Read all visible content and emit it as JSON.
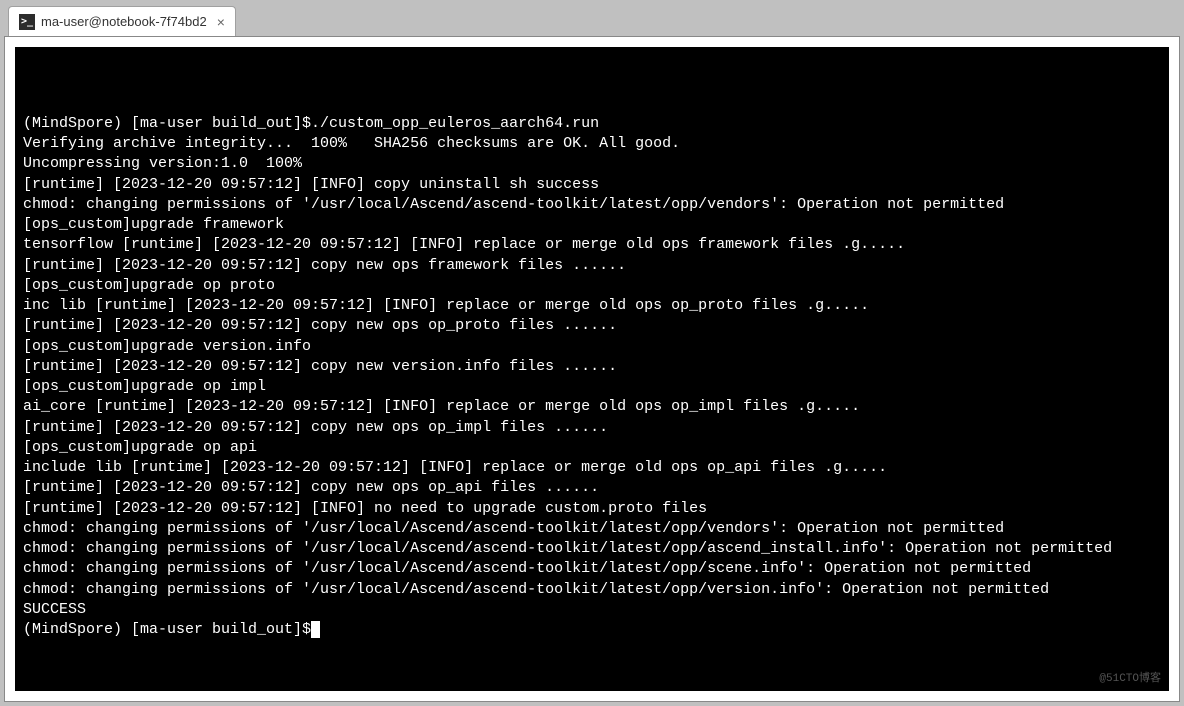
{
  "tab": {
    "title": "ma-user@notebook-7f74bd2",
    "icon_glyph": ">_"
  },
  "terminal": {
    "lines": [
      "(MindSpore) [ma-user build_out]$./custom_opp_euleros_aarch64.run",
      "Verifying archive integrity...  100%   SHA256 checksums are OK. All good.",
      "Uncompressing version:1.0  100%",
      "[runtime] [2023-12-20 09:57:12] [INFO] copy uninstall sh success",
      "chmod: changing permissions of '/usr/local/Ascend/ascend-toolkit/latest/opp/vendors': Operation not permitted",
      "[ops_custom]upgrade framework",
      "tensorflow [runtime] [2023-12-20 09:57:12] [INFO] replace or merge old ops framework files .g.....",
      "[runtime] [2023-12-20 09:57:12] copy new ops framework files ......",
      "[ops_custom]upgrade op proto",
      "inc lib [runtime] [2023-12-20 09:57:12] [INFO] replace or merge old ops op_proto files .g.....",
      "[runtime] [2023-12-20 09:57:12] copy new ops op_proto files ......",
      "[ops_custom]upgrade version.info",
      "[runtime] [2023-12-20 09:57:12] copy new version.info files ......",
      "[ops_custom]upgrade op impl",
      "ai_core [runtime] [2023-12-20 09:57:12] [INFO] replace or merge old ops op_impl files .g.....",
      "[runtime] [2023-12-20 09:57:12] copy new ops op_impl files ......",
      "[ops_custom]upgrade op api",
      "include lib [runtime] [2023-12-20 09:57:12] [INFO] replace or merge old ops op_api files .g.....",
      "[runtime] [2023-12-20 09:57:12] copy new ops op_api files ......",
      "[runtime] [2023-12-20 09:57:12] [INFO] no need to upgrade custom.proto files",
      "chmod: changing permissions of '/usr/local/Ascend/ascend-toolkit/latest/opp/vendors': Operation not permitted",
      "chmod: changing permissions of '/usr/local/Ascend/ascend-toolkit/latest/opp/ascend_install.info': Operation not permitted",
      "chmod: changing permissions of '/usr/local/Ascend/ascend-toolkit/latest/opp/scene.info': Operation not permitted",
      "chmod: changing permissions of '/usr/local/Ascend/ascend-toolkit/latest/opp/version.info': Operation not permitted",
      "SUCCESS"
    ],
    "prompt": "(MindSpore) [ma-user build_out]$"
  },
  "watermark": "@51CTO博客"
}
